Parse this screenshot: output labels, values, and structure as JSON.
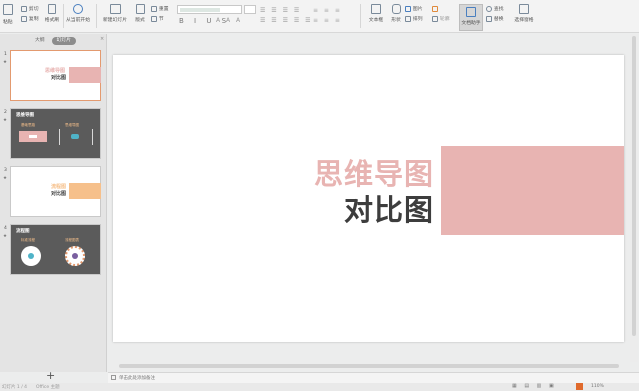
{
  "ribbon": {
    "paste": "粘贴",
    "cut": "剪切",
    "copy": "复制",
    "format_painter": "格式刷",
    "from_start": "从当前开始",
    "new_slide": "新建幻灯片",
    "layout": "版式",
    "section": "节",
    "reset": "重置",
    "textbox": "文本框",
    "shape": "形状",
    "picture": "图片",
    "arrange": "排列",
    "outline": "轮廓",
    "doc_assistant": "文档助手",
    "find": "查找",
    "replace": "替换",
    "select_pane": "选择窗格"
  },
  "sidebar": {
    "tab_outline": "大纲",
    "tab_slides": "幻灯片",
    "slides": [
      {
        "num": "1",
        "title_pink": "思维导图",
        "title_dark": "对比图"
      },
      {
        "num": "2",
        "title": "思维导图",
        "left_label": "基础思路",
        "right_label": "思维导图"
      },
      {
        "num": "3",
        "title_orange": "流程图",
        "title_dark": "对比图"
      },
      {
        "num": "4",
        "title": "流程图",
        "left_label": "标准流程",
        "right_label": "流程图表"
      }
    ],
    "add_label": "+"
  },
  "slide": {
    "title_line1": "思维导图",
    "title_line2": "对比图"
  },
  "notes": {
    "placeholder": "单击此处添加备注"
  },
  "status": {
    "slide_info": "幻灯片 1 / 4",
    "theme": "Office 主题",
    "zoom": "110%"
  },
  "colors": {
    "accent_pink": "#e8b4b2",
    "accent_orange": "#f6c08b",
    "dark_text": "#3d3d3d"
  }
}
